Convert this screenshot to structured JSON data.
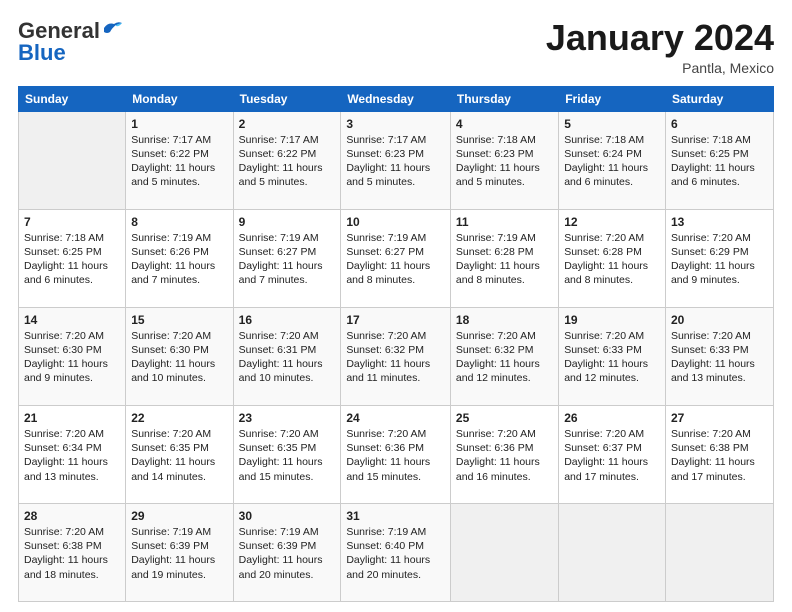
{
  "header": {
    "logo_general": "General",
    "logo_blue": "Blue",
    "month_title": "January 2024",
    "location": "Pantla, Mexico"
  },
  "weekdays": [
    "Sunday",
    "Monday",
    "Tuesday",
    "Wednesday",
    "Thursday",
    "Friday",
    "Saturday"
  ],
  "weeks": [
    [
      {
        "day": "",
        "empty": true
      },
      {
        "day": "1",
        "sunrise": "Sunrise: 7:17 AM",
        "sunset": "Sunset: 6:22 PM",
        "daylight": "Daylight: 11 hours and 5 minutes."
      },
      {
        "day": "2",
        "sunrise": "Sunrise: 7:17 AM",
        "sunset": "Sunset: 6:22 PM",
        "daylight": "Daylight: 11 hours and 5 minutes."
      },
      {
        "day": "3",
        "sunrise": "Sunrise: 7:17 AM",
        "sunset": "Sunset: 6:23 PM",
        "daylight": "Daylight: 11 hours and 5 minutes."
      },
      {
        "day": "4",
        "sunrise": "Sunrise: 7:18 AM",
        "sunset": "Sunset: 6:23 PM",
        "daylight": "Daylight: 11 hours and 5 minutes."
      },
      {
        "day": "5",
        "sunrise": "Sunrise: 7:18 AM",
        "sunset": "Sunset: 6:24 PM",
        "daylight": "Daylight: 11 hours and 6 minutes."
      },
      {
        "day": "6",
        "sunrise": "Sunrise: 7:18 AM",
        "sunset": "Sunset: 6:25 PM",
        "daylight": "Daylight: 11 hours and 6 minutes."
      }
    ],
    [
      {
        "day": "7",
        "sunrise": "Sunrise: 7:18 AM",
        "sunset": "Sunset: 6:25 PM",
        "daylight": "Daylight: 11 hours and 6 minutes."
      },
      {
        "day": "8",
        "sunrise": "Sunrise: 7:19 AM",
        "sunset": "Sunset: 6:26 PM",
        "daylight": "Daylight: 11 hours and 7 minutes."
      },
      {
        "day": "9",
        "sunrise": "Sunrise: 7:19 AM",
        "sunset": "Sunset: 6:27 PM",
        "daylight": "Daylight: 11 hours and 7 minutes."
      },
      {
        "day": "10",
        "sunrise": "Sunrise: 7:19 AM",
        "sunset": "Sunset: 6:27 PM",
        "daylight": "Daylight: 11 hours and 8 minutes."
      },
      {
        "day": "11",
        "sunrise": "Sunrise: 7:19 AM",
        "sunset": "Sunset: 6:28 PM",
        "daylight": "Daylight: 11 hours and 8 minutes."
      },
      {
        "day": "12",
        "sunrise": "Sunrise: 7:20 AM",
        "sunset": "Sunset: 6:28 PM",
        "daylight": "Daylight: 11 hours and 8 minutes."
      },
      {
        "day": "13",
        "sunrise": "Sunrise: 7:20 AM",
        "sunset": "Sunset: 6:29 PM",
        "daylight": "Daylight: 11 hours and 9 minutes."
      }
    ],
    [
      {
        "day": "14",
        "sunrise": "Sunrise: 7:20 AM",
        "sunset": "Sunset: 6:30 PM",
        "daylight": "Daylight: 11 hours and 9 minutes."
      },
      {
        "day": "15",
        "sunrise": "Sunrise: 7:20 AM",
        "sunset": "Sunset: 6:30 PM",
        "daylight": "Daylight: 11 hours and 10 minutes."
      },
      {
        "day": "16",
        "sunrise": "Sunrise: 7:20 AM",
        "sunset": "Sunset: 6:31 PM",
        "daylight": "Daylight: 11 hours and 10 minutes."
      },
      {
        "day": "17",
        "sunrise": "Sunrise: 7:20 AM",
        "sunset": "Sunset: 6:32 PM",
        "daylight": "Daylight: 11 hours and 11 minutes."
      },
      {
        "day": "18",
        "sunrise": "Sunrise: 7:20 AM",
        "sunset": "Sunset: 6:32 PM",
        "daylight": "Daylight: 11 hours and 12 minutes."
      },
      {
        "day": "19",
        "sunrise": "Sunrise: 7:20 AM",
        "sunset": "Sunset: 6:33 PM",
        "daylight": "Daylight: 11 hours and 12 minutes."
      },
      {
        "day": "20",
        "sunrise": "Sunrise: 7:20 AM",
        "sunset": "Sunset: 6:33 PM",
        "daylight": "Daylight: 11 hours and 13 minutes."
      }
    ],
    [
      {
        "day": "21",
        "sunrise": "Sunrise: 7:20 AM",
        "sunset": "Sunset: 6:34 PM",
        "daylight": "Daylight: 11 hours and 13 minutes."
      },
      {
        "day": "22",
        "sunrise": "Sunrise: 7:20 AM",
        "sunset": "Sunset: 6:35 PM",
        "daylight": "Daylight: 11 hours and 14 minutes."
      },
      {
        "day": "23",
        "sunrise": "Sunrise: 7:20 AM",
        "sunset": "Sunset: 6:35 PM",
        "daylight": "Daylight: 11 hours and 15 minutes."
      },
      {
        "day": "24",
        "sunrise": "Sunrise: 7:20 AM",
        "sunset": "Sunset: 6:36 PM",
        "daylight": "Daylight: 11 hours and 15 minutes."
      },
      {
        "day": "25",
        "sunrise": "Sunrise: 7:20 AM",
        "sunset": "Sunset: 6:36 PM",
        "daylight": "Daylight: 11 hours and 16 minutes."
      },
      {
        "day": "26",
        "sunrise": "Sunrise: 7:20 AM",
        "sunset": "Sunset: 6:37 PM",
        "daylight": "Daylight: 11 hours and 17 minutes."
      },
      {
        "day": "27",
        "sunrise": "Sunrise: 7:20 AM",
        "sunset": "Sunset: 6:38 PM",
        "daylight": "Daylight: 11 hours and 17 minutes."
      }
    ],
    [
      {
        "day": "28",
        "sunrise": "Sunrise: 7:20 AM",
        "sunset": "Sunset: 6:38 PM",
        "daylight": "Daylight: 11 hours and 18 minutes."
      },
      {
        "day": "29",
        "sunrise": "Sunrise: 7:19 AM",
        "sunset": "Sunset: 6:39 PM",
        "daylight": "Daylight: 11 hours and 19 minutes."
      },
      {
        "day": "30",
        "sunrise": "Sunrise: 7:19 AM",
        "sunset": "Sunset: 6:39 PM",
        "daylight": "Daylight: 11 hours and 20 minutes."
      },
      {
        "day": "31",
        "sunrise": "Sunrise: 7:19 AM",
        "sunset": "Sunset: 6:40 PM",
        "daylight": "Daylight: 11 hours and 20 minutes."
      },
      {
        "day": "",
        "empty": true
      },
      {
        "day": "",
        "empty": true
      },
      {
        "day": "",
        "empty": true
      }
    ]
  ]
}
